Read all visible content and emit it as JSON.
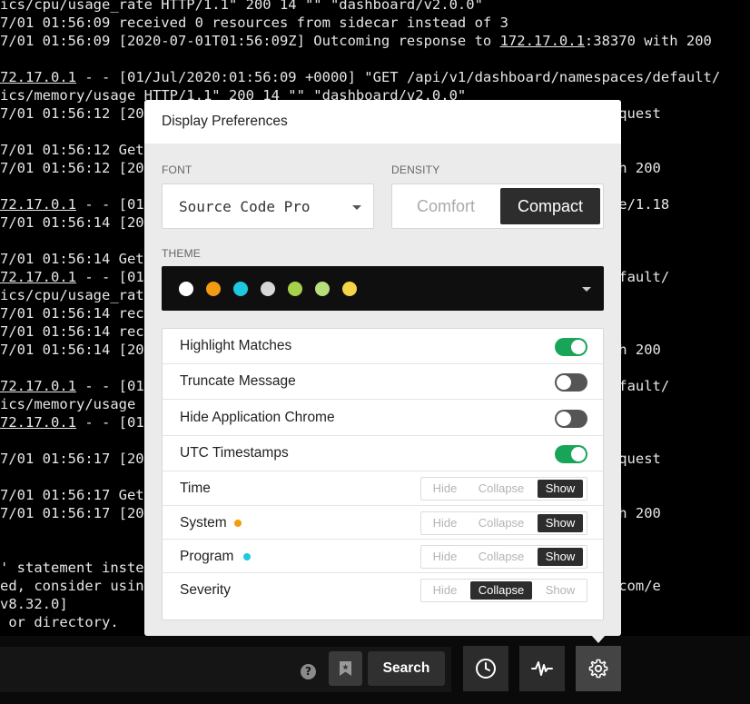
{
  "log_lines": [
    {
      "text": "ics/cpu/usage_rate HTTP/1.1\" 200 14 \"\" \"dashboard/v2.0.0\""
    },
    {
      "text": "7/01 01:56:09 received 0 resources from sidecar instead of 3"
    },
    {
      "text": "7/01 01:56:09 [2020-07-01T01:56:09Z] Outcoming response to 172.17.0.1:38370 with 200"
    },
    {
      "text": ""
    },
    {
      "text": "72.17.0.1 - - [01/Jul/2020:01:56:09 +0000] \"GET /api/v1/dashboard/namespaces/default/"
    },
    {
      "text": "ics/memory/usage HTTP/1.1\" 200 14 \"\" \"dashboard/v2.0.0\""
    },
    {
      "text": "7/01 01:56:12 [20                                               espace request"
    },
    {
      "text": ""
    },
    {
      "text": "7/01 01:56:12 Get"
    },
    {
      "text": "7/01 01:56:12 [20                                               38370 with 200"
    },
    {
      "text": ""
    },
    {
      "text": "72.17.0.1 - - [01                                               kube-probe/1.18"
    },
    {
      "text": "7/01 01:56:14 [20                                               licaset"
    },
    {
      "text": ""
    },
    {
      "text": "7/01 01:56:14 Get"
    },
    {
      "text": "72.17.0.1 - - [01                                               spaces/default/"
    },
    {
      "text": "ics/cpu/usage_rat"
    },
    {
      "text": "7/01 01:56:14 rec"
    },
    {
      "text": "7/01 01:56:14 rec"
    },
    {
      "text": "7/01 01:56:14 [20                                               38370 with 200"
    },
    {
      "text": ""
    },
    {
      "text": "72.17.0.1 - - [01                                               spaces/default/"
    },
    {
      "text": "ics/memory/usage"
    },
    {
      "text": "72.17.0.1 - - [01                                                13 \"\""
    },
    {
      "text": ""
    },
    {
      "text": "7/01 01:56:17 [20                                               espace request"
    },
    {
      "text": ""
    },
    {
      "text": "7/01 01:56:17 Get"
    },
    {
      "text": "7/01 01:56:17 [20                                               38370 with 200"
    },
    {
      "text": ""
    },
    {
      "text": ""
    },
    {
      "text": "' statement inste"
    },
    {
      "text": "ed, consider usin                                              w.rsyslog.com/e"
    },
    {
      "text": "v8.32.0]"
    },
    {
      "text": " or directory."
    }
  ],
  "panel": {
    "title": "Display Preferences",
    "font_label": "FONT",
    "font_value": "Source Code Pro",
    "density_label": "DENSITY",
    "density_options": [
      "Comfort",
      "Compact"
    ],
    "density_selected": "Compact",
    "theme_label": "THEME",
    "theme_swatches": [
      "#ffffff",
      "#f39c12",
      "#1ec8e0",
      "#d8d8d8",
      "#a7d14a",
      "#b8e07a",
      "#f5d547"
    ],
    "toggles": [
      {
        "label": "Highlight Matches",
        "on": true
      },
      {
        "label": "Truncate Message",
        "on": false
      },
      {
        "label": "Hide Application Chrome",
        "on": false
      },
      {
        "label": "UTC Timestamps",
        "on": true
      }
    ],
    "segmented_options": [
      "Hide",
      "Collapse",
      "Show"
    ],
    "fields": [
      {
        "label": "Time",
        "selected": "Show",
        "dot_color": ""
      },
      {
        "label": "System",
        "selected": "Show",
        "dot_color": "#f39c12"
      },
      {
        "label": "Program",
        "selected": "Show",
        "dot_color": "#1ec8e0"
      },
      {
        "label": "Severity",
        "selected": "Collapse",
        "dot_color": ""
      }
    ]
  },
  "toolbar": {
    "help_label": "?",
    "search_label": "Search",
    "icons": [
      "help-icon",
      "bookmark-icon",
      "clock-icon",
      "activity-icon",
      "gear-icon"
    ]
  },
  "colors": {
    "toggle_on": "#18a558",
    "toggle_off": "#555555",
    "active_segment": "#2d2d2d"
  }
}
